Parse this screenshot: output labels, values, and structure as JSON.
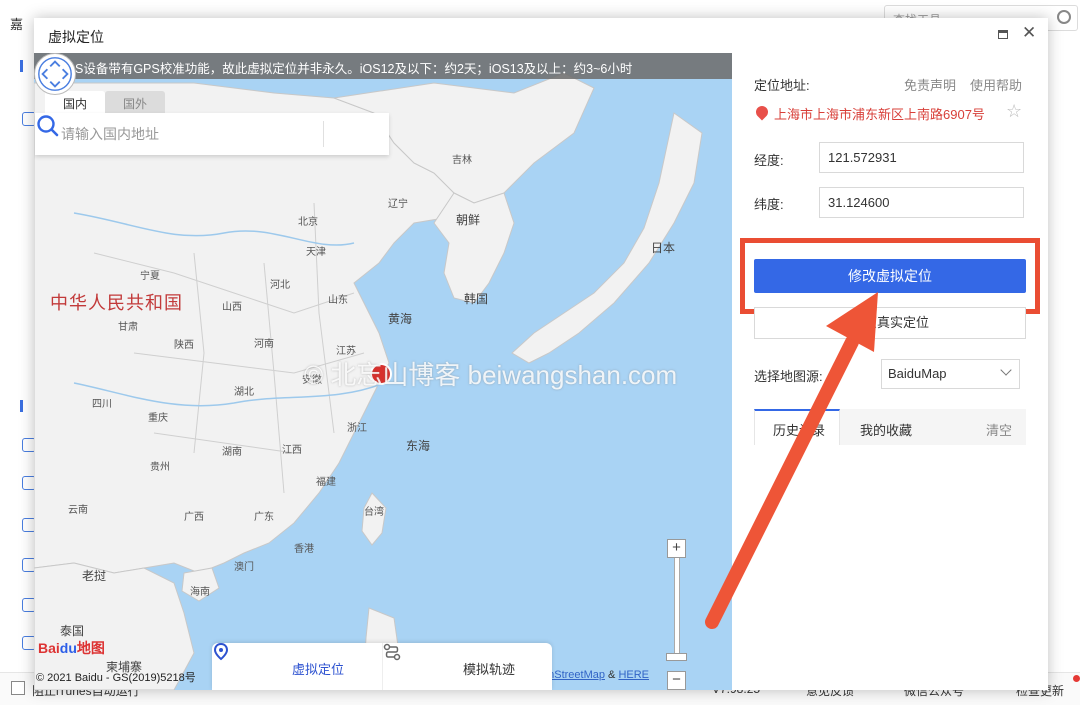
{
  "background_app": {
    "left_title": "嘉",
    "search_placeholder": "查找工具",
    "footer": {
      "checkbox_label": "阻止iTunes自动运行",
      "version": "V7.98.25",
      "feedback": "意见反馈",
      "wechat": "微信公众号",
      "update": "检查更新"
    }
  },
  "dialog": {
    "title": "虚拟定位",
    "notice": "因iOS设备带有GPS校准功能，故此虚拟定位并非永久。iOS12及以下：约2天；iOS13及以上：约3~6小时",
    "search": {
      "tab_domestic": "国内",
      "tab_foreign": "国外",
      "placeholder": "请输入国内地址"
    },
    "map": {
      "country_label": "中华人民共和国",
      "region_labels": {
        "jilin": "吉林",
        "liaoning": "辽宁",
        "beijing": "北京",
        "tianjin": "天津",
        "hebei": "河北",
        "shanxi": "山西",
        "shandong": "山东",
        "henan": "河南",
        "jiangsu": "江苏",
        "anhui": "安徽",
        "hubei": "湖北",
        "zhejiang": "浙江",
        "hunan": "湖南",
        "jiangxi": "江西",
        "fujian": "福建",
        "guangdong": "广东",
        "guangxi": "广西",
        "guizhou": "贵州",
        "yunnan": "云南",
        "sichuan": "四川",
        "chongqing": "重庆",
        "shaanxi": "陕西",
        "gansu": "甘肃",
        "ningxia": "宁夏",
        "taiwan": "台湾",
        "hainan": "海南",
        "hongkong": "香港",
        "macau": "澳门",
        "laos": "老挝",
        "thailand": "泰国",
        "cambodia": "柬埔寨",
        "north_korea": "朝鲜",
        "south_korea": "韩国",
        "japan": "日本",
        "yellow_sea": "黄海",
        "east_sea": "东海"
      },
      "watermark": "© 北忘山博客 beiwangshan.com",
      "baidu_logo_a": "Bai",
      "baidu_logo_b": "du",
      "baidu_logo_c": "地图",
      "copyright": "© 2021 Baidu - GS(2019)5218号",
      "osm_text": "enStreetMap",
      "osm_amp": "&",
      "osm_here": "HERE",
      "zoom_in": "+",
      "zoom_out": "−"
    },
    "bottom_tabs": {
      "virtual": "虚拟定位",
      "track": "模拟轨迹"
    },
    "panel": {
      "location_label": "定位地址:",
      "disclaimer": "免责声明",
      "help": "使用帮助",
      "address": "上海市上海市浦东新区上南路6907号",
      "longitude_label": "经度:",
      "longitude": "121.572931",
      "latitude_label": "纬度:",
      "latitude": "31.124600",
      "modify_button": "修改虚拟定位",
      "restore_button": "还原真实定位",
      "map_source_label": "选择地图源:",
      "map_source": "BaiduMap",
      "tab_history": "历史记录",
      "tab_favorites": "我的收藏",
      "clear": "清空"
    }
  },
  "colors": {
    "accent": "#3468e6",
    "annotation_red": "#ea4d33",
    "sea": "#a9d3f4",
    "land": "#f2f2f2"
  }
}
